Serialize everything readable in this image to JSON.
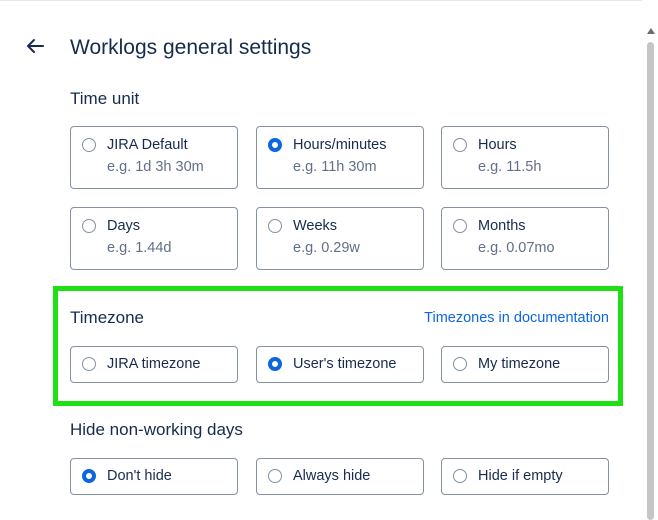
{
  "header": {
    "title": "Worklogs general settings"
  },
  "time_unit": {
    "label": "Time unit",
    "options": [
      {
        "label": "JIRA Default",
        "example": "e.g. 1d 3h 30m",
        "checked": false
      },
      {
        "label": "Hours/minutes",
        "example": "e.g. 11h 30m",
        "checked": true
      },
      {
        "label": "Hours",
        "example": "e.g. 11.5h",
        "checked": false
      },
      {
        "label": "Days",
        "example": "e.g. 1.44d",
        "checked": false
      },
      {
        "label": "Weeks",
        "example": "e.g. 0.29w",
        "checked": false
      },
      {
        "label": "Months",
        "example": "e.g. 0.07mo",
        "checked": false
      }
    ]
  },
  "timezone": {
    "label": "Timezone",
    "doc_link": "Timezones in documentation",
    "options": [
      {
        "label": "JIRA timezone",
        "checked": false
      },
      {
        "label": "User's timezone",
        "checked": true
      },
      {
        "label": "My timezone",
        "checked": false
      }
    ]
  },
  "hide_days": {
    "label": "Hide non-working days",
    "options": [
      {
        "label": "Don't hide",
        "checked": true
      },
      {
        "label": "Always hide",
        "checked": false
      },
      {
        "label": "Hide if empty",
        "checked": false
      }
    ]
  },
  "colors": {
    "accent": "#0c66e4",
    "highlight": "#1ee014",
    "text": "#172b4d",
    "subtle_text": "#626f86",
    "border": "#8590a2"
  },
  "icons": {
    "back": "arrow-left-icon"
  }
}
